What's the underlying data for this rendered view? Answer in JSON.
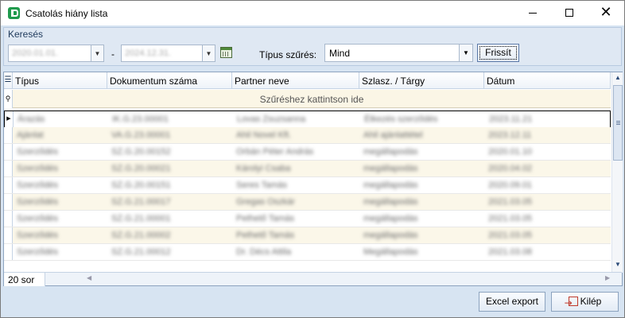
{
  "window": {
    "title": "Csatolás hiány lista",
    "app_icon": "app-logo-icon",
    "controls": [
      "minimize-icon",
      "maximize-icon",
      "close-icon"
    ]
  },
  "search": {
    "caption": "Keresés",
    "date_from": "2020.01.01.",
    "date_separator": "-",
    "date_to": "2024.12.31.",
    "calendar_icon": "calendar-icon",
    "filter_label": "Típus szűrés:",
    "filter_value": "Mind",
    "refresh_label": "Frissít"
  },
  "grid": {
    "columns": [
      "Típus",
      "Dokumentum száma",
      "Partner neve",
      "Szlasz. / Tárgy",
      "Dátum"
    ],
    "filter_hint": "Szűréshez kattintson ide",
    "rows": [
      [
        "Árazás",
        "IK.G.23.00001",
        "Lovas Zsuzsanna",
        "Étkezés szerződés",
        "2023.11.21"
      ],
      [
        "Ajánlat",
        "VA.G.23.00001",
        "Ahil Novel Kft.",
        "Ahil ajánlattétel",
        "2023.12.11"
      ],
      [
        "Szerződés",
        "SZ.G.20.00152",
        "Orbán Péter András",
        "megállapodás",
        "2020.01.10"
      ],
      [
        "Szerződés",
        "SZ.G.20.00021",
        "Károlyi Csaba",
        "megállapodás",
        "2020.04.02"
      ],
      [
        "Szerződés",
        "SZ.G.20.00151",
        "Seres Tamás",
        "megállapodás",
        "2020.09.01"
      ],
      [
        "Szerződés",
        "SZ.G.21.00017",
        "Gregas Oszkár",
        "megállapodás",
        "2021.03.05"
      ],
      [
        "Szerződés",
        "SZ.G.21.00001",
        "Pethető Tamás",
        "megállapodás",
        "2021.03.05"
      ],
      [
        "Szerződés",
        "SZ.G.21.00002",
        "Pethető Tamás",
        "megállapodás",
        "2021.03.05"
      ],
      [
        "Szerződés",
        "SZ.G.21.00012",
        "Dr. Décs Attila",
        "Megállapodás",
        "2021.03.08"
      ]
    ],
    "row_count": "20 sor"
  },
  "footer": {
    "export_label": "Excel export",
    "exit_label": "Kilép",
    "exit_icon": "exit-icon"
  }
}
